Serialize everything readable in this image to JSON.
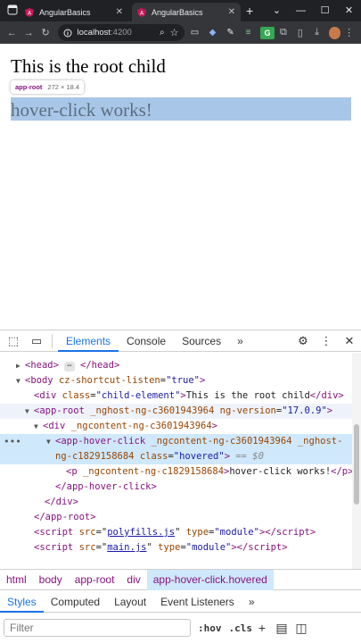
{
  "browser": {
    "tabs": [
      {
        "title": "AngularBasics",
        "active": false
      },
      {
        "title": "AngularBasics",
        "active": true
      }
    ],
    "new_tab": "+",
    "window_controls": [
      "⌄",
      "—",
      "☐",
      "✕"
    ],
    "address": {
      "host": "localhost",
      "port": ":4200"
    }
  },
  "page": {
    "root_child_text": "This is the root child",
    "hover_text": "hover-click works!",
    "tooltip": {
      "tag": "app-root",
      "dims": "272 × 18.4"
    }
  },
  "devtools": {
    "tabs": [
      "Elements",
      "Console",
      "Sources"
    ],
    "more": "»",
    "dom": {
      "head": {
        "open": "<head>",
        "close": "</head>"
      },
      "body": {
        "tag": "body",
        "attr": "cz-shortcut-listen",
        "val": "\"true\""
      },
      "div_child": {
        "tag": "div",
        "attr": "class",
        "val": "\"child-element\"",
        "text": "This is the root child",
        "close": "</div>"
      },
      "app_root": {
        "tag": "app-root",
        "attr1": "_nghost-ng-c3601943964",
        "attr2": "ng-version",
        "val2": "\"17.0.9\""
      },
      "div_content": {
        "tag": "div",
        "attr": "_ngcontent-ng-c3601943964"
      },
      "app_hover": {
        "tag": "app-hover-click",
        "attr1": "_ngcontent-ng-c3601943964",
        "attr2": "_nghost-",
        "attr2b": "ng-c1829158684",
        "attr3": "class",
        "val3": "\"hovered\"",
        "suffix": "== $0"
      },
      "p": {
        "tag": "p",
        "attr": "_ngcontent-ng-c1829158684",
        "text": "hover-click works!",
        "close": "</p>"
      },
      "close_app_hover": "</app-hover-click>",
      "close_div": "</div>",
      "close_app_root": "</app-root>",
      "script1": {
        "tag": "script",
        "src": "polyfills.js",
        "type": "\"module\""
      },
      "script2": {
        "tag": "script",
        "src": "main.js",
        "type": "\"module\""
      }
    },
    "breadcrumbs": [
      "html",
      "body",
      "app-root",
      "div",
      "app-hover-click.hovered"
    ],
    "subtabs": [
      "Styles",
      "Computed",
      "Layout",
      "Event Listeners"
    ],
    "filter_placeholder": "Filter",
    "hov_label": ":hov",
    "cls_label": ".cls"
  }
}
